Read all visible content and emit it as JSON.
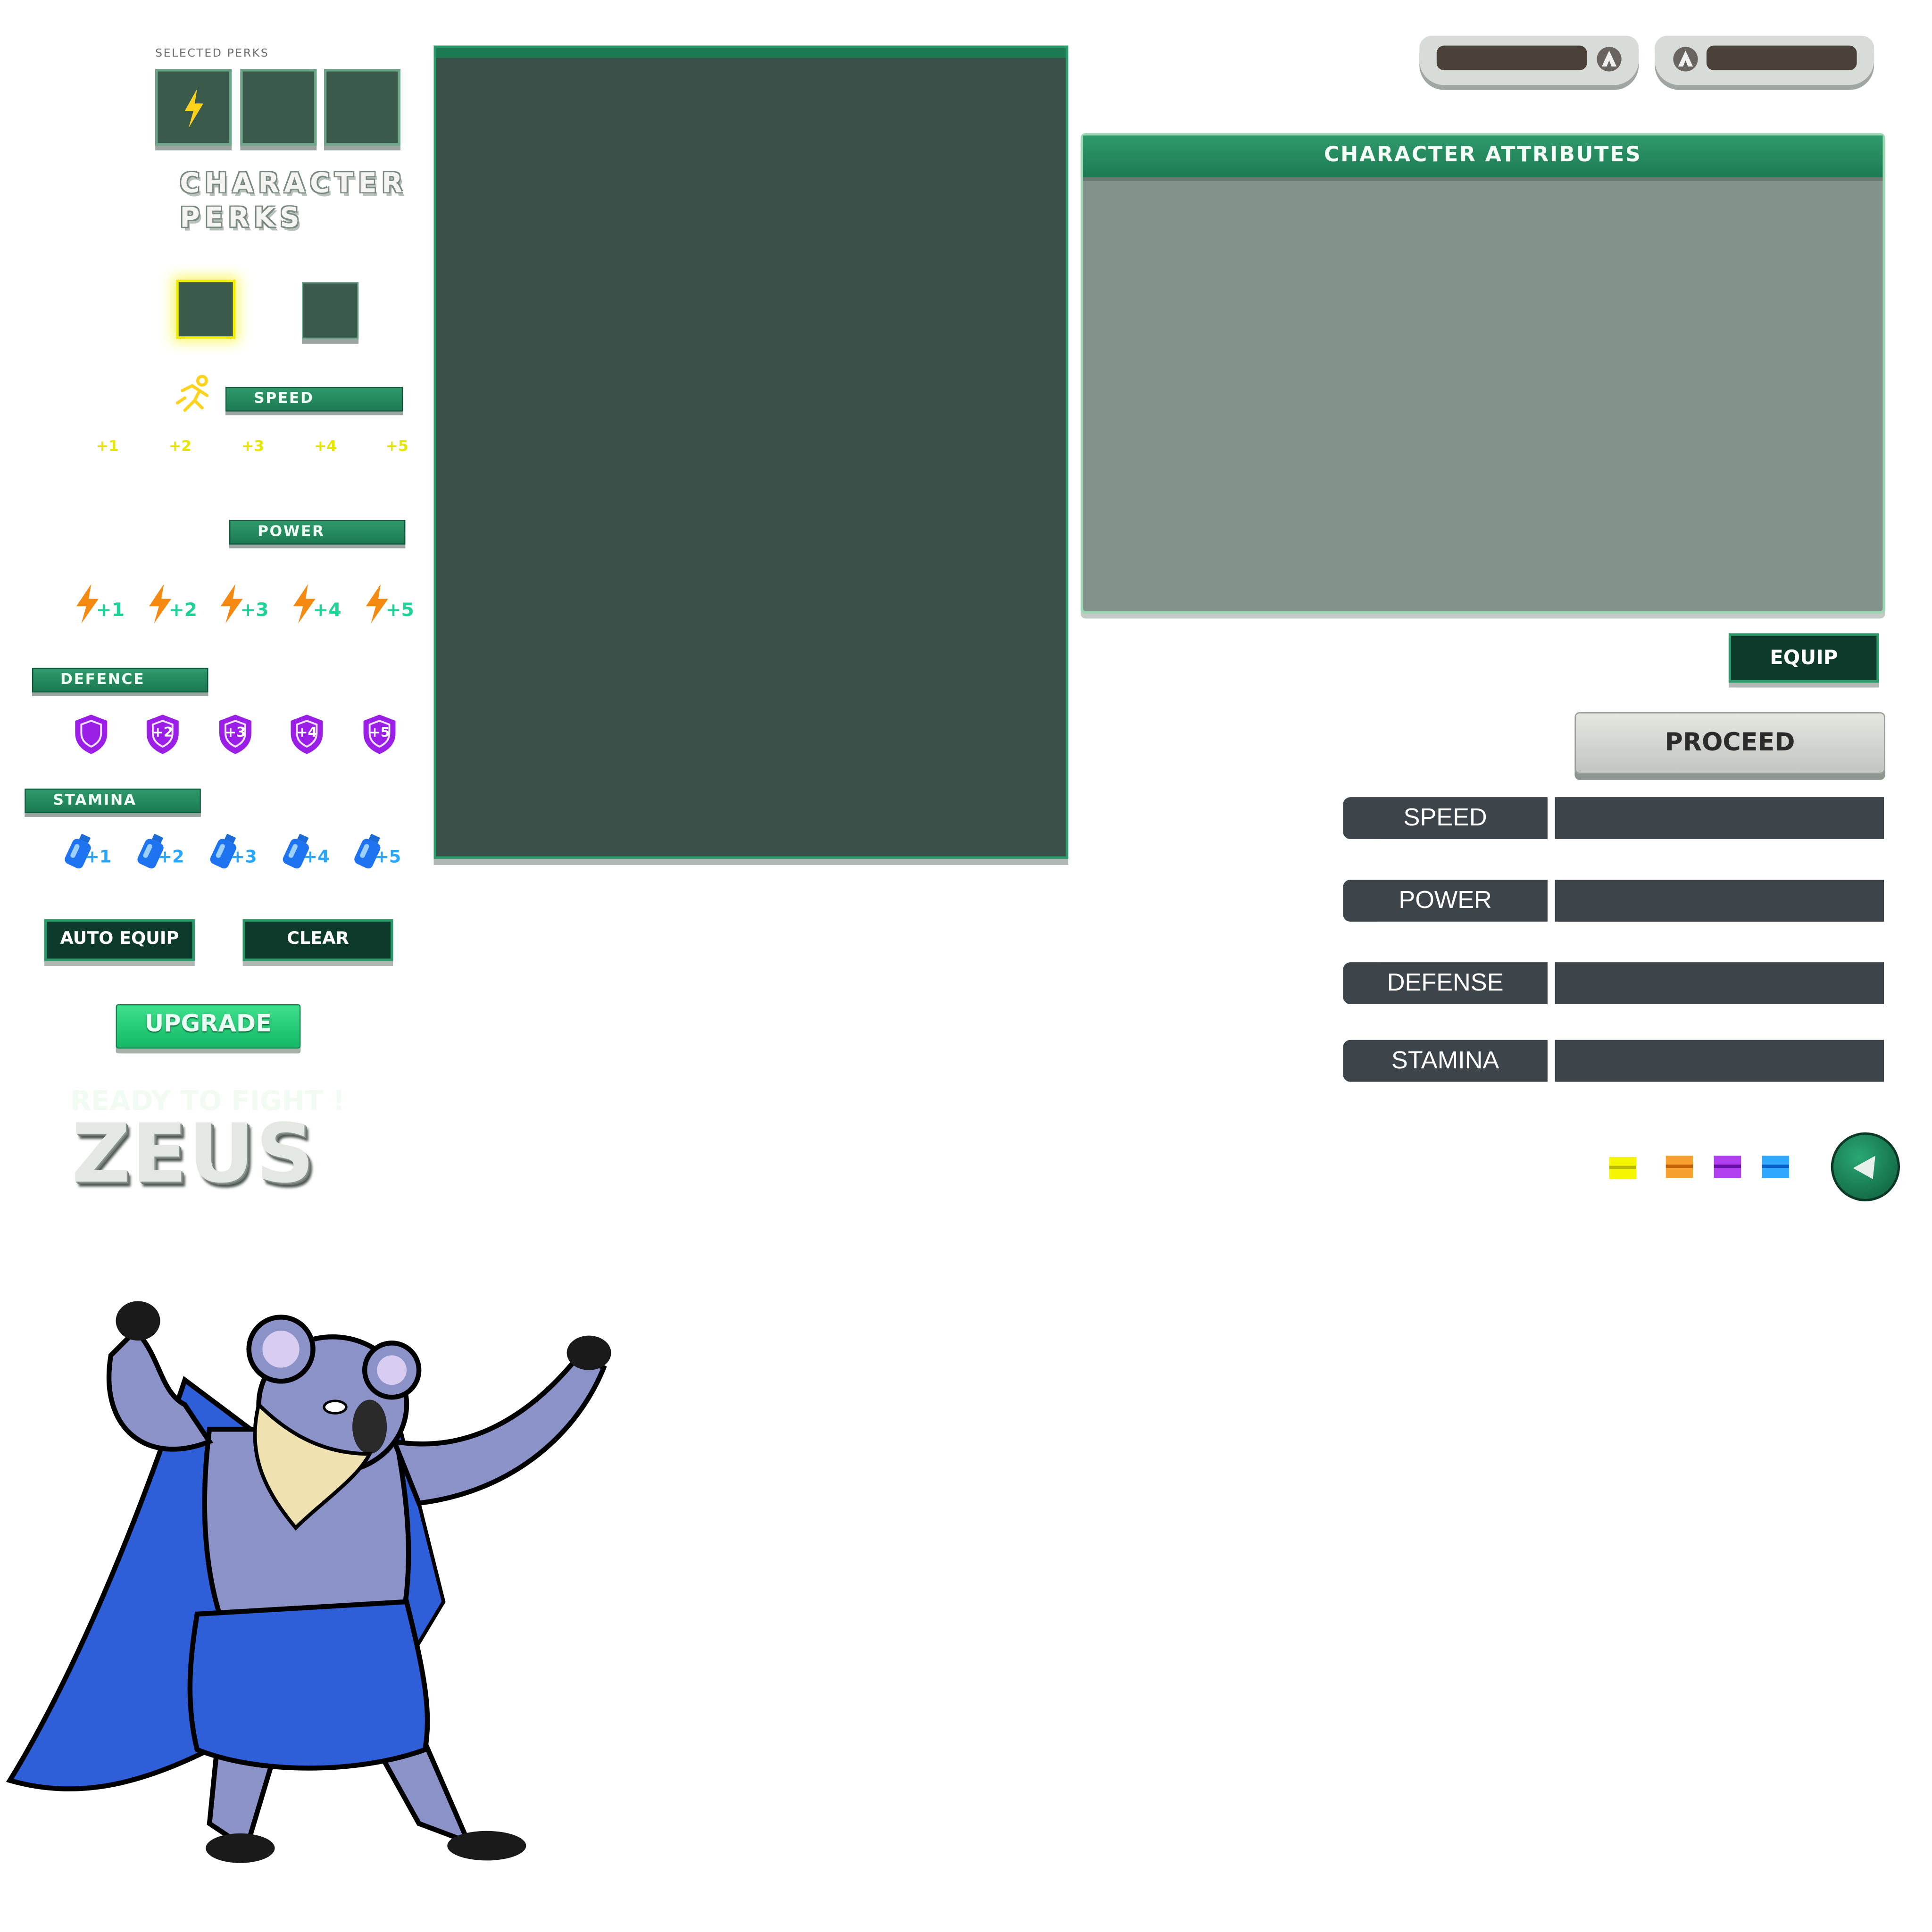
{
  "selected_perks": {
    "label": "SELECTED PERKS",
    "slots": [
      "bolt-icon",
      "",
      ""
    ]
  },
  "character_perks_title": [
    "CHARACTER",
    "PERKS"
  ],
  "speed_section": {
    "tag": "SPEED",
    "levels": [
      "+1",
      "+2",
      "+3",
      "+4",
      "+5"
    ]
  },
  "power_section": {
    "tag": "POWER",
    "levels": [
      "+1",
      "+2",
      "+3",
      "+4",
      "+5"
    ]
  },
  "defence_section": {
    "tag": "DEFENCE",
    "levels": [
      "",
      "+2",
      "+3",
      "+4",
      "+5"
    ]
  },
  "stamina_section": {
    "tag": "STAMINA",
    "levels": [
      "+1",
      "+2",
      "+3",
      "+4",
      "+5"
    ]
  },
  "buttons": {
    "auto_equip": "AUTO EQUIP",
    "clear": "CLEAR",
    "upgrade": "UPGRADE",
    "equip": "EQUIP",
    "proceed": "PROCEED"
  },
  "ready_text": "READY TO FIGHT !",
  "character_name": "ZEUS",
  "attributes_panel": {
    "title": "CHARACTER ATTRIBUTES"
  },
  "stats": [
    {
      "label": "SPEED"
    },
    {
      "label": "POWER"
    },
    {
      "label": "DEFENSE"
    },
    {
      "label": "STAMINA"
    }
  ],
  "colors": {
    "panel_green": "#3a5a4c",
    "accent_green": "#1c7a52",
    "swatches": [
      "#e6e600",
      "#f08c00",
      "#9a1ee6",
      "#1e90ff"
    ]
  }
}
